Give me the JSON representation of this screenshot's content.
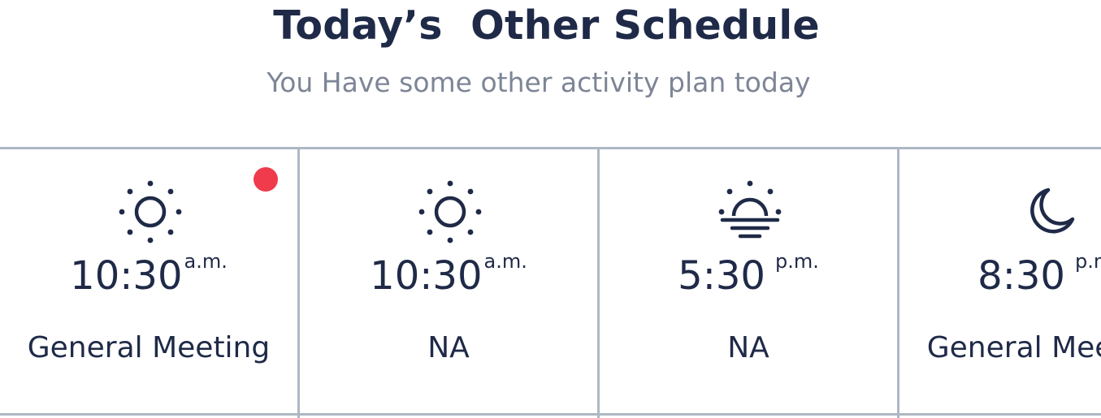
{
  "header": {
    "title": "Today’s  Other Schedule",
    "subtitle": "You Have some other activity plan today"
  },
  "colors": {
    "primary_text": "#1f2a48",
    "muted_text": "#7d8596",
    "border": "#aeb8c4",
    "notification_dot": "#ef3b4c"
  },
  "schedule": [
    {
      "icon": "sun-icon",
      "time": "10:30",
      "period": "a.m.",
      "label": "General Meeting",
      "has_notification": true
    },
    {
      "icon": "sun-icon",
      "time": "10:30",
      "period": "a.m.",
      "label": "NA",
      "has_notification": false
    },
    {
      "icon": "sunset-icon",
      "time": "5:30",
      "period": "p.m.",
      "label": "NA",
      "has_notification": false
    },
    {
      "icon": "moon-icon",
      "time": "8:30",
      "period": "p.m.",
      "label": "General Meeting",
      "has_notification": false
    }
  ]
}
